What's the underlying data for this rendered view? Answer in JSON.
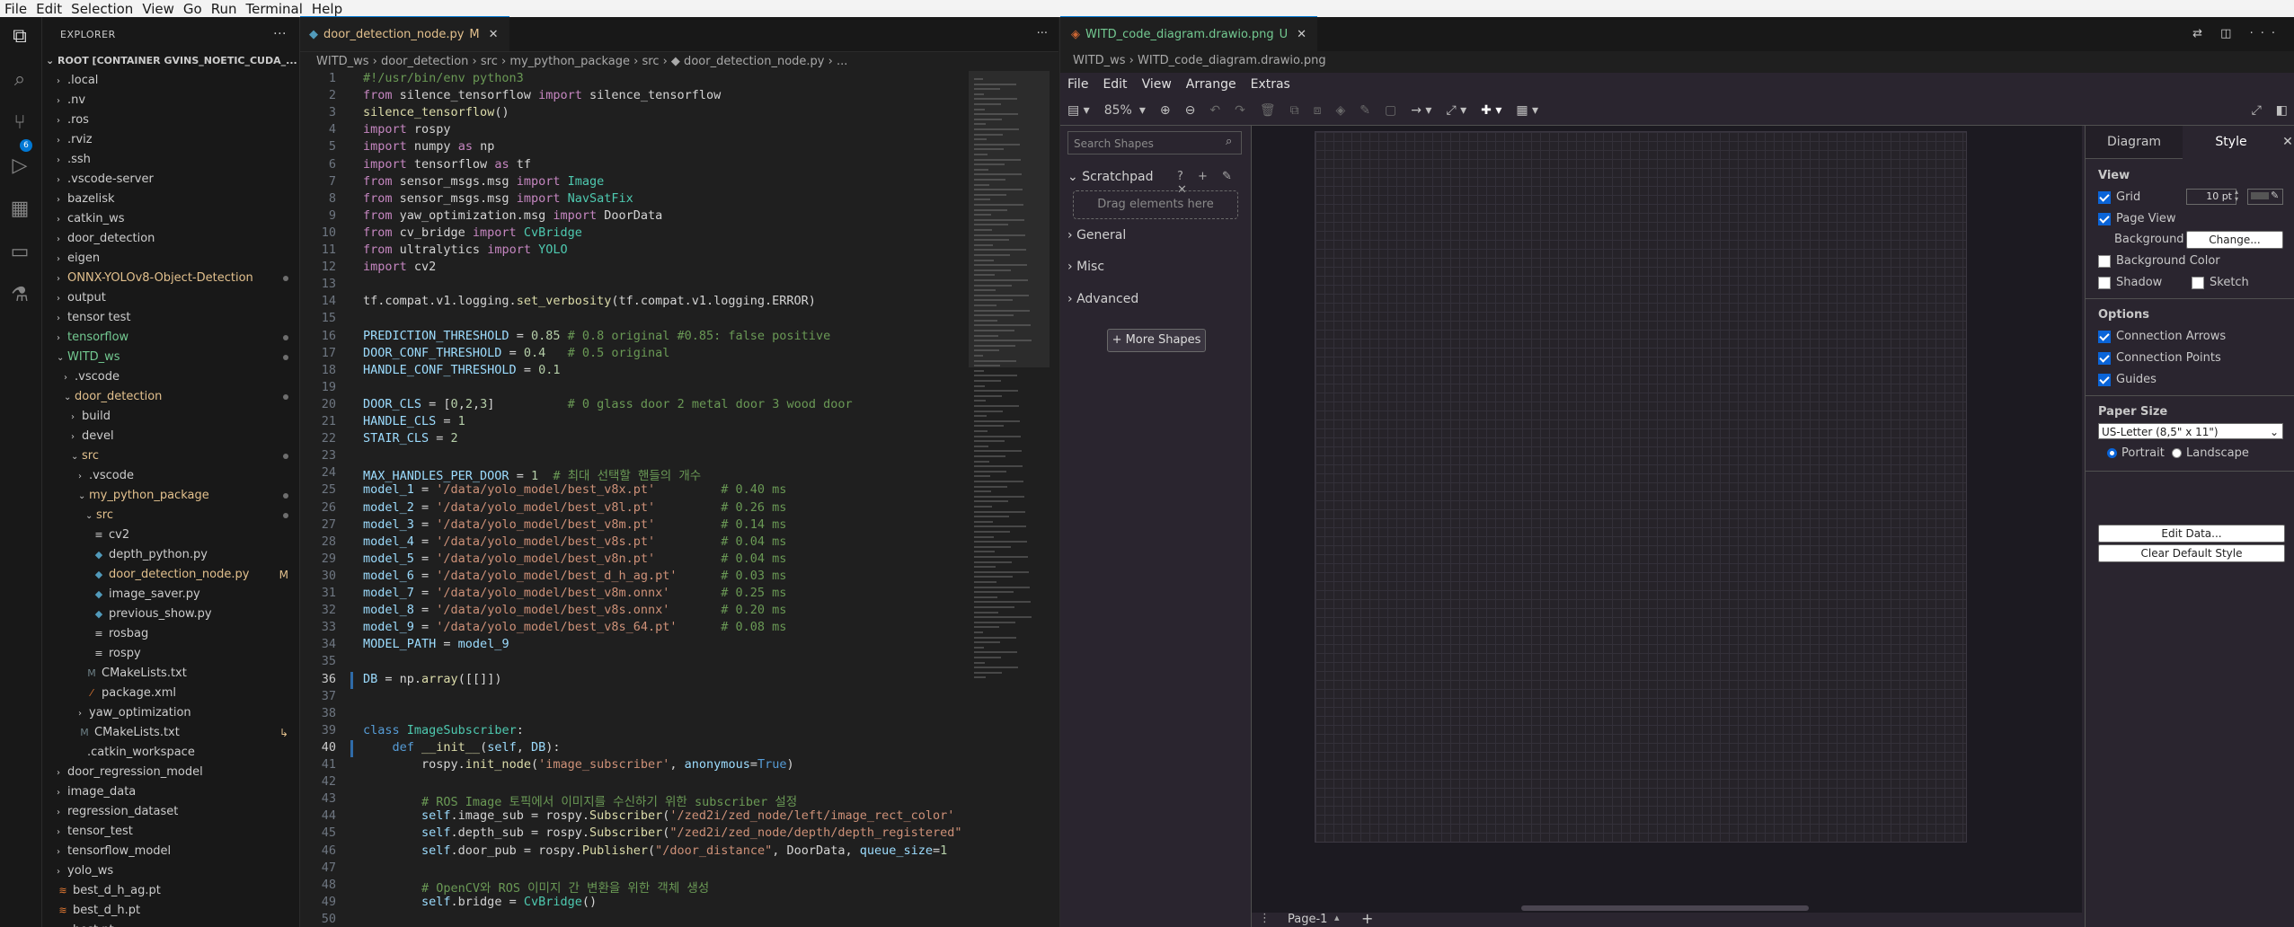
{
  "menubar": [
    "File",
    "Edit",
    "Selection",
    "View",
    "Go",
    "Run",
    "Terminal",
    "Help"
  ],
  "explorer": {
    "title": "EXPLORER",
    "root": "ROOT [CONTAINER GVINS_NOETIC_CUDA_...",
    "rows": [
      {
        "label": ".local",
        "indent": 1,
        "type": "folder",
        "color": "#cccccc"
      },
      {
        "label": ".nv",
        "indent": 1,
        "type": "folder",
        "color": "#cccccc"
      },
      {
        "label": ".ros",
        "indent": 1,
        "type": "folder",
        "color": "#cccccc"
      },
      {
        "label": ".rviz",
        "indent": 1,
        "type": "folder",
        "color": "#cccccc"
      },
      {
        "label": ".ssh",
        "indent": 1,
        "type": "folder",
        "color": "#cccccc"
      },
      {
        "label": ".vscode-server",
        "indent": 1,
        "type": "folder",
        "color": "#cccccc"
      },
      {
        "label": "bazelisk",
        "indent": 1,
        "type": "folder",
        "color": "#cccccc"
      },
      {
        "label": "catkin_ws",
        "indent": 1,
        "type": "folder",
        "color": "#cccccc"
      },
      {
        "label": "door_detection",
        "indent": 1,
        "type": "folder",
        "color": "#cccccc"
      },
      {
        "label": "eigen",
        "indent": 1,
        "type": "folder",
        "color": "#cccccc"
      },
      {
        "label": "ONNX-YOLOv8-Object-Detection",
        "indent": 1,
        "type": "folder",
        "color": "#e2c08d",
        "dot": true
      },
      {
        "label": "output",
        "indent": 1,
        "type": "folder",
        "color": "#cccccc"
      },
      {
        "label": "tensor test",
        "indent": 1,
        "type": "folder",
        "color": "#cccccc"
      },
      {
        "label": "tensorflow",
        "indent": 1,
        "type": "folder",
        "color": "#73c991",
        "dot": true
      },
      {
        "label": "WITD_ws",
        "indent": 1,
        "type": "open",
        "color": "#73c991",
        "dot": true
      },
      {
        "label": ".vscode",
        "indent": 2,
        "type": "folder",
        "color": "#cccccc"
      },
      {
        "label": "door_detection",
        "indent": 2,
        "type": "open",
        "color": "#e2c08d",
        "dot": true
      },
      {
        "label": "build",
        "indent": 3,
        "type": "folder",
        "color": "#cccccc"
      },
      {
        "label": "devel",
        "indent": 3,
        "type": "folder",
        "color": "#cccccc"
      },
      {
        "label": "src",
        "indent": 3,
        "type": "open",
        "color": "#e2c08d",
        "dot": true
      },
      {
        "label": ".vscode",
        "indent": 4,
        "type": "folder",
        "color": "#cccccc"
      },
      {
        "label": "my_python_package",
        "indent": 4,
        "type": "open",
        "color": "#e2c08d",
        "dot": true
      },
      {
        "label": "src",
        "indent": 5,
        "type": "open",
        "color": "#e2c08d",
        "dot": true
      },
      {
        "label": "cv2",
        "indent": 6,
        "type": "file",
        "icon": "≡",
        "iconColor": "#cccccc",
        "color": "#cccccc"
      },
      {
        "label": "depth_python.py",
        "indent": 6,
        "type": "file",
        "icon": "◆",
        "iconColor": "#519aba",
        "color": "#cccccc"
      },
      {
        "label": "door_detection_node.py",
        "indent": 6,
        "type": "file",
        "icon": "◆",
        "iconColor": "#519aba",
        "color": "#e2c08d",
        "mark": "M"
      },
      {
        "label": "image_saver.py",
        "indent": 6,
        "type": "file",
        "icon": "◆",
        "iconColor": "#519aba",
        "color": "#cccccc"
      },
      {
        "label": "previous_show.py",
        "indent": 6,
        "type": "file",
        "icon": "◆",
        "iconColor": "#519aba",
        "color": "#cccccc"
      },
      {
        "label": "rosbag",
        "indent": 6,
        "type": "file",
        "icon": "≡",
        "iconColor": "#cccccc",
        "color": "#cccccc"
      },
      {
        "label": "rospy",
        "indent": 6,
        "type": "file",
        "icon": "≡",
        "iconColor": "#cccccc",
        "color": "#cccccc"
      },
      {
        "label": "CMakeLists.txt",
        "indent": 5,
        "type": "file",
        "icon": "M",
        "iconColor": "#6d8086",
        "color": "#cccccc"
      },
      {
        "label": "package.xml",
        "indent": 5,
        "type": "file",
        "icon": "⁄",
        "iconColor": "#e37933",
        "color": "#cccccc"
      },
      {
        "label": "yaw_optimization",
        "indent": 4,
        "type": "folder",
        "color": "#cccccc"
      },
      {
        "label": "CMakeLists.txt",
        "indent": 4,
        "type": "file",
        "icon": "M",
        "iconColor": "#6d8086",
        "color": "#cccccc",
        "mark": "↳"
      },
      {
        "label": ".catkin_workspace",
        "indent": 3,
        "type": "file",
        "icon": " ",
        "iconColor": "#cccccc",
        "color": "#cccccc"
      },
      {
        "label": "door_regression_model",
        "indent": 1,
        "type": "folder",
        "color": "#cccccc"
      },
      {
        "label": "image_data",
        "indent": 1,
        "type": "folder",
        "color": "#cccccc"
      },
      {
        "label": "regression_dataset",
        "indent": 1,
        "type": "folder",
        "color": "#cccccc"
      },
      {
        "label": "tensor_test",
        "indent": 1,
        "type": "folder",
        "color": "#cccccc"
      },
      {
        "label": "tensorflow_model",
        "indent": 1,
        "type": "folder",
        "color": "#cccccc"
      },
      {
        "label": "yolo_ws",
        "indent": 1,
        "type": "folder",
        "color": "#cccccc"
      },
      {
        "label": "best_d_h_ag.pt",
        "indent": 1,
        "type": "file",
        "icon": "≋",
        "iconColor": "#e37933",
        "color": "#cccccc"
      },
      {
        "label": "best_d_h.pt",
        "indent": 1,
        "type": "file",
        "icon": "≋",
        "iconColor": "#e37933",
        "color": "#cccccc"
      },
      {
        "label": "best.pt",
        "indent": 1,
        "type": "file",
        "icon": "≋",
        "iconColor": "#e37933",
        "color": "#cccccc"
      }
    ]
  },
  "editor": {
    "tab_label": "door_detection_node.py",
    "tab_mark": "M",
    "breadcrumb": "WITD_ws › door_detection › src › my_python_package › src › ◆ door_detection_node.py › ...",
    "lines": [
      [
        [
          "#!/usr/bin/env python3",
          "cm"
        ]
      ],
      [
        [
          "from ",
          "kw"
        ],
        [
          "silence_tensorflow ",
          "df"
        ],
        [
          "import ",
          "kw"
        ],
        [
          "silence_tensorflow",
          "df"
        ]
      ],
      [
        [
          "silence_tensorflow",
          "fn"
        ],
        [
          "()",
          "df"
        ]
      ],
      [
        [
          "import ",
          "kw"
        ],
        [
          "rospy",
          "df"
        ]
      ],
      [
        [
          "import ",
          "kw"
        ],
        [
          "numpy ",
          "df"
        ],
        [
          "as ",
          "kw"
        ],
        [
          "np",
          "df"
        ]
      ],
      [
        [
          "import ",
          "kw"
        ],
        [
          "tensorflow ",
          "df"
        ],
        [
          "as ",
          "kw"
        ],
        [
          "tf",
          "df"
        ]
      ],
      [
        [
          "from ",
          "kw"
        ],
        [
          "sensor_msgs.msg ",
          "df"
        ],
        [
          "import ",
          "kw"
        ],
        [
          "Image",
          "cls"
        ]
      ],
      [
        [
          "from ",
          "kw"
        ],
        [
          "sensor_msgs.msg ",
          "df"
        ],
        [
          "import ",
          "kw"
        ],
        [
          "NavSatFix",
          "cls"
        ]
      ],
      [
        [
          "from ",
          "kw"
        ],
        [
          "yaw_optimization.msg ",
          "df"
        ],
        [
          "import ",
          "kw"
        ],
        [
          "DoorData",
          "df"
        ]
      ],
      [
        [
          "from ",
          "kw"
        ],
        [
          "cv_bridge ",
          "df"
        ],
        [
          "import ",
          "kw"
        ],
        [
          "CvBridge",
          "cls"
        ]
      ],
      [
        [
          "from ",
          "kw"
        ],
        [
          "ultralytics ",
          "df"
        ],
        [
          "import ",
          "kw"
        ],
        [
          "YOLO",
          "cls"
        ]
      ],
      [
        [
          "import ",
          "kw"
        ],
        [
          "cv2",
          "df"
        ]
      ],
      [
        [
          "",
          ""
        ]
      ],
      [
        [
          "tf.compat.v1.logging.",
          "df"
        ],
        [
          "set_verbosity",
          "fn"
        ],
        [
          "(tf.compat.v1.logging.ERROR)",
          "df"
        ]
      ],
      [
        [
          "",
          ""
        ]
      ],
      [
        [
          "PREDICTION_THRESHOLD",
          "vr"
        ],
        [
          " = ",
          "df"
        ],
        [
          "0.85",
          "nm"
        ],
        [
          " # 0.8 original #0.85: false positive",
          "cm"
        ]
      ],
      [
        [
          "DOOR_CONF_THRESHOLD",
          "vr"
        ],
        [
          " = ",
          "df"
        ],
        [
          "0.4",
          "nm"
        ],
        [
          "   # 0.5 original",
          "cm"
        ]
      ],
      [
        [
          "HANDLE_CONF_THRESHOLD",
          "vr"
        ],
        [
          " = ",
          "df"
        ],
        [
          "0.1",
          "nm"
        ]
      ],
      [
        [
          "",
          ""
        ]
      ],
      [
        [
          "DOOR_CLS",
          "vr"
        ],
        [
          " = [",
          "df"
        ],
        [
          "0",
          "nm"
        ],
        [
          ",",
          "df"
        ],
        [
          "2",
          "nm"
        ],
        [
          ",",
          "df"
        ],
        [
          "3",
          "nm"
        ],
        [
          "]          ",
          "df"
        ],
        [
          "# 0 glass door 2 metal door 3 wood door",
          "cm"
        ]
      ],
      [
        [
          "HANDLE_CLS",
          "vr"
        ],
        [
          " = ",
          "df"
        ],
        [
          "1",
          "nm"
        ]
      ],
      [
        [
          "STAIR_CLS",
          "vr"
        ],
        [
          " = ",
          "df"
        ],
        [
          "2",
          "nm"
        ]
      ],
      [
        [
          "",
          ""
        ]
      ],
      [
        [
          "MAX_HANDLES_PER_DOOR",
          "vr"
        ],
        [
          " = ",
          "df"
        ],
        [
          "1",
          "nm"
        ],
        [
          "  # 최대 선택할 핸들의 개수",
          "cm"
        ]
      ],
      [
        [
          "model_1",
          "vr"
        ],
        [
          " = ",
          "df"
        ],
        [
          "'/data/yolo_model/best_v8x.pt'",
          "st"
        ],
        [
          "         # 0.40 ms",
          "cm"
        ]
      ],
      [
        [
          "model_2",
          "vr"
        ],
        [
          " = ",
          "df"
        ],
        [
          "'/data/yolo_model/best_v8l.pt'",
          "st"
        ],
        [
          "         # 0.26 ms",
          "cm"
        ]
      ],
      [
        [
          "model_3",
          "vr"
        ],
        [
          " = ",
          "df"
        ],
        [
          "'/data/yolo_model/best_v8m.pt'",
          "st"
        ],
        [
          "         # 0.14 ms",
          "cm"
        ]
      ],
      [
        [
          "model_4",
          "vr"
        ],
        [
          " = ",
          "df"
        ],
        [
          "'/data/yolo_model/best_v8s.pt'",
          "st"
        ],
        [
          "         # 0.04 ms",
          "cm"
        ]
      ],
      [
        [
          "model_5",
          "vr"
        ],
        [
          " = ",
          "df"
        ],
        [
          "'/data/yolo_model/best_v8n.pt'",
          "st"
        ],
        [
          "         # 0.04 ms",
          "cm"
        ]
      ],
      [
        [
          "model_6",
          "vr"
        ],
        [
          " = ",
          "df"
        ],
        [
          "'/data/yolo_model/best_d_h_ag.pt'",
          "st"
        ],
        [
          "      # 0.03 ms",
          "cm"
        ]
      ],
      [
        [
          "model_7",
          "vr"
        ],
        [
          " = ",
          "df"
        ],
        [
          "'/data/yolo_model/best_v8m.onnx'",
          "st"
        ],
        [
          "       # 0.25 ms",
          "cm"
        ]
      ],
      [
        [
          "model_8",
          "vr"
        ],
        [
          " = ",
          "df"
        ],
        [
          "'/data/yolo_model/best_v8s.onnx'",
          "st"
        ],
        [
          "       # 0.20 ms",
          "cm"
        ]
      ],
      [
        [
          "model_9",
          "vr"
        ],
        [
          " = ",
          "df"
        ],
        [
          "'/data/yolo_model/best_v8s_64.pt'",
          "st"
        ],
        [
          "      # 0.08 ms",
          "cm"
        ]
      ],
      [
        [
          "MODEL_PATH",
          "vr"
        ],
        [
          " = ",
          "df"
        ],
        [
          "model_9",
          "vr"
        ]
      ],
      [
        [
          "",
          ""
        ]
      ],
      [
        [
          "DB",
          "vr"
        ],
        [
          " = np.",
          "df"
        ],
        [
          "array",
          "fn"
        ],
        [
          "([[]])",
          "df"
        ]
      ],
      [
        [
          "",
          ""
        ]
      ],
      [
        [
          "",
          ""
        ]
      ],
      [
        [
          "class ",
          "bl"
        ],
        [
          "ImageSubscriber",
          "cls"
        ],
        [
          ":",
          "df"
        ]
      ],
      [
        [
          "    ",
          "df"
        ],
        [
          "def ",
          "bl"
        ],
        [
          "__init__",
          "fn"
        ],
        [
          "(",
          "df"
        ],
        [
          "self",
          "vr"
        ],
        [
          ", ",
          "df"
        ],
        [
          "DB",
          "vr"
        ],
        [
          "):",
          "df"
        ]
      ],
      [
        [
          "        rospy.",
          "df"
        ],
        [
          "init_node",
          "fn"
        ],
        [
          "(",
          "df"
        ],
        [
          "'image_subscriber'",
          "st"
        ],
        [
          ", ",
          "df"
        ],
        [
          "anonymous",
          "vr"
        ],
        [
          "=",
          "df"
        ],
        [
          "True",
          "bl"
        ],
        [
          ")",
          "df"
        ]
      ],
      [
        [
          "",
          ""
        ]
      ],
      [
        [
          "        ",
          "df"
        ],
        [
          "# ROS Image 토픽에서 이미지를 수신하기 위한 subscriber 설정",
          "cm"
        ]
      ],
      [
        [
          "        ",
          "df"
        ],
        [
          "self",
          "vr"
        ],
        [
          ".image_sub = rospy.",
          "df"
        ],
        [
          "Subscriber",
          "fn"
        ],
        [
          "(",
          "df"
        ],
        [
          "'/zed2i/zed_node/left/image_rect_color'",
          "st"
        ]
      ],
      [
        [
          "        ",
          "df"
        ],
        [
          "self",
          "vr"
        ],
        [
          ".depth_sub = rospy.",
          "df"
        ],
        [
          "Subscriber",
          "fn"
        ],
        [
          "(",
          "df"
        ],
        [
          "\"/zed2i/zed_node/depth/depth_registered\"",
          "st"
        ]
      ],
      [
        [
          "        ",
          "df"
        ],
        [
          "self",
          "vr"
        ],
        [
          ".door_pub = rospy.",
          "df"
        ],
        [
          "Publisher",
          "fn"
        ],
        [
          "(",
          "df"
        ],
        [
          "\"/door_distance\"",
          "st"
        ],
        [
          ", DoorData, ",
          "df"
        ],
        [
          "queue_size",
          "vr"
        ],
        [
          "=",
          "df"
        ],
        [
          "1",
          "nm"
        ]
      ],
      [
        [
          "",
          ""
        ]
      ],
      [
        [
          "        ",
          "df"
        ],
        [
          "# OpenCV와 ROS 이미지 간 변환을 위한 객체 생성",
          "cm"
        ]
      ],
      [
        [
          "        ",
          "df"
        ],
        [
          "self",
          "vr"
        ],
        [
          ".bridge = ",
          "df"
        ],
        [
          "CvBridge",
          "cls"
        ],
        [
          "()",
          "df"
        ]
      ],
      [
        [
          "",
          ""
        ]
      ]
    ]
  },
  "drawio_tab": {
    "tab_label": "WITD_code_diagram.drawio.png",
    "tab_mark": "U",
    "breadcrumb": "WITD_ws › WITD_code_diagram.drawio.png"
  },
  "drawio": {
    "menu": [
      "File",
      "Edit",
      "View",
      "Arrange",
      "Extras"
    ],
    "zoom": "85%",
    "search_placeholder": "Search Shapes",
    "scratchpad": "Scratchpad",
    "drag_hint": "Drag elements here",
    "sections": [
      "General",
      "Misc",
      "Advanced"
    ],
    "more_shapes": "More Shapes",
    "page_tab": "Page-1",
    "format": {
      "tab_diagram": "Diagram",
      "tab_style": "Style",
      "view_title": "View",
      "grid": "Grid",
      "grid_size": "10 pt",
      "page_view": "Page View",
      "background": "Background",
      "change": "Change...",
      "background_color": "Background Color",
      "shadow": "Shadow",
      "sketch": "Sketch",
      "options_title": "Options",
      "connection_arrows": "Connection Arrows",
      "connection_points": "Connection Points",
      "guides": "Guides",
      "paper_size_title": "Paper Size",
      "paper_size": "US-Letter (8,5\" x 11\")",
      "portrait": "Portrait",
      "landscape": "Landscape",
      "edit_data": "Edit Data...",
      "clear_default_style": "Clear Default Style"
    }
  }
}
